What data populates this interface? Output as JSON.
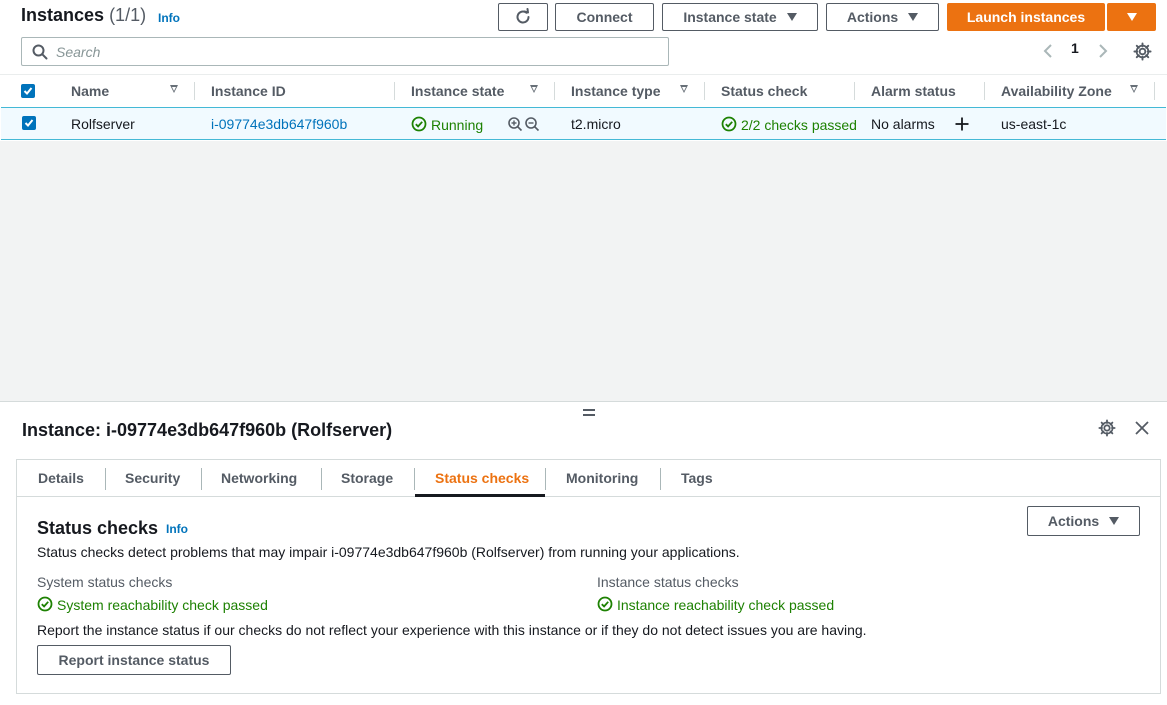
{
  "header": {
    "title": "Instances",
    "count": "(1/1)",
    "info": "Info",
    "connect": "Connect",
    "instance_state": "Instance state",
    "actions": "Actions",
    "launch": "Launch instances"
  },
  "search": {
    "placeholder": "Search"
  },
  "pagination": {
    "page": "1"
  },
  "table": {
    "columns": [
      "Name",
      "Instance ID",
      "Instance state",
      "Instance type",
      "Status check",
      "Alarm status",
      "Availability Zone"
    ],
    "row": {
      "name": "Rolfserver",
      "instance_id": "i-09774e3db647f960b",
      "state": "Running",
      "type": "t2.micro",
      "status_check": "2/2 checks passed",
      "alarm": "No alarms",
      "zone": "us-east-1c"
    }
  },
  "panel": {
    "title": "Instance: i-09774e3db647f960b (Rolfserver)",
    "tabs": [
      "Details",
      "Security",
      "Networking",
      "Storage",
      "Status checks",
      "Monitoring",
      "Tags"
    ],
    "active_tab": "Status checks",
    "section_title": "Status checks",
    "info": "Info",
    "actions": "Actions",
    "description": "Status checks detect problems that may impair i-09774e3db647f960b (Rolfserver) from running your applications.",
    "system_label": "System status checks",
    "system_value": "System reachability check passed",
    "instance_label": "Instance status checks",
    "instance_value": "Instance reachability check passed",
    "report_text": "Report the instance status if our checks do not reflect your experience with this instance or if they do not detect issues you are having.",
    "report_button": "Report instance status"
  },
  "colors": {
    "accent": "#ec7211",
    "link": "#0073bb",
    "success": "#1d8102",
    "selected_row": "#f1faff"
  }
}
